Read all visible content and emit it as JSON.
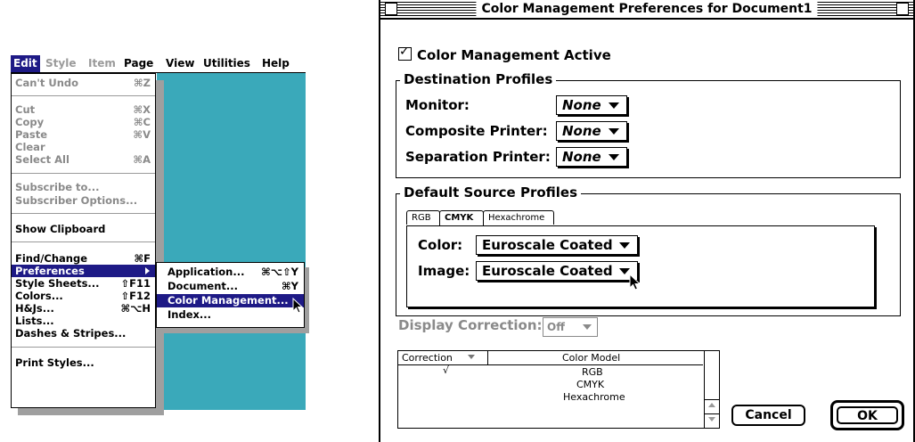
{
  "menubar": {
    "items": [
      "Edit",
      "Style",
      "Item",
      "Page",
      "View",
      "Utilities",
      "Help"
    ]
  },
  "edit_menu": {
    "items": [
      {
        "label": "Can't Undo",
        "key": "⌘Z"
      },
      {
        "label": "Cut",
        "key": "⌘X"
      },
      {
        "label": "Copy",
        "key": "⌘C"
      },
      {
        "label": "Paste",
        "key": "⌘V"
      },
      {
        "label": "Clear",
        "key": ""
      },
      {
        "label": "Select All",
        "key": "⌘A"
      },
      {
        "label": "Subscribe to...",
        "key": ""
      },
      {
        "label": "Subscriber Options...",
        "key": ""
      },
      {
        "label": "Show Clipboard",
        "key": ""
      },
      {
        "label": "Find/Change",
        "key": "⌘F"
      },
      {
        "label": "Preferences",
        "key": ""
      },
      {
        "label": "Style Sheets...",
        "key": "⇧F11"
      },
      {
        "label": "Colors...",
        "key": "⇧F12"
      },
      {
        "label": "H&Js...",
        "key": "⌘⌥H"
      },
      {
        "label": "Lists...",
        "key": ""
      },
      {
        "label": "Dashes & Stripes...",
        "key": ""
      },
      {
        "label": "Print Styles...",
        "key": ""
      }
    ]
  },
  "preferences_submenu": {
    "items": [
      {
        "label": "Application...",
        "key": "⌘⌥⇧Y"
      },
      {
        "label": "Document...",
        "key": "⌘Y"
      },
      {
        "label": "Color Management...",
        "key": ""
      },
      {
        "label": "Index...",
        "key": ""
      }
    ]
  },
  "dialog": {
    "title": "Color Management Preferences for Document1",
    "active_label": "Color Management Active",
    "destination": {
      "title": "Destination Profiles",
      "monitor_label": "Monitor:",
      "composite_label": "Composite Printer:",
      "separation_label": "Separation Printer:",
      "monitor_value": "None",
      "composite_value": "None",
      "separation_value": "None"
    },
    "source": {
      "title": "Default Source Profiles",
      "tabs": [
        "RGB",
        "CMYK",
        "Hexachrome"
      ],
      "color_label": "Color:",
      "image_label": "Image:",
      "color_value": "Euroscale Coated",
      "image_value": "Euroscale Coated"
    },
    "display_correction": {
      "label": "Display Correction:",
      "value": "Off"
    },
    "table": {
      "col1": "Correction",
      "col2": "Color Model",
      "check": "√",
      "models": [
        "RGB",
        "CMYK",
        "Hexachrome"
      ]
    },
    "cancel_label": "Cancel",
    "ok_label": "OK"
  }
}
